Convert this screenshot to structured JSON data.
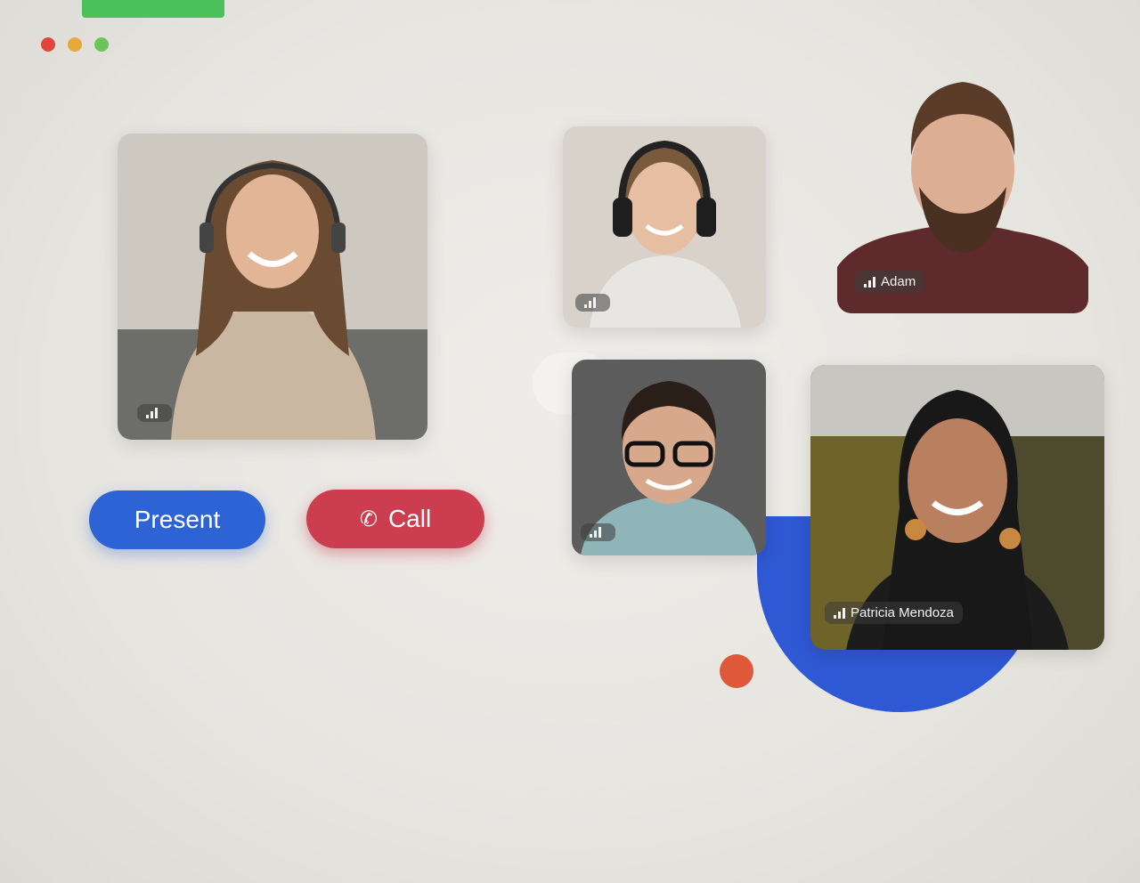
{
  "window": {
    "dots": [
      {
        "name": "close-dot",
        "color": "#e0463d"
      },
      {
        "name": "minimize-dot",
        "color": "#e9a83a"
      },
      {
        "name": "maximize-dot",
        "color": "#6cc35a"
      }
    ]
  },
  "participants": [
    {
      "name": "",
      "role_badge": "",
      "icon": "signal-icon"
    },
    {
      "name": "",
      "icon": "signal-icon"
    },
    {
      "name": "Adam",
      "icon": "signal-icon"
    },
    {
      "name": "",
      "icon": "signal-icon"
    },
    {
      "name": "Patricia Mendoza",
      "icon": "signal-icon"
    }
  ],
  "controls": {
    "present_label": "Present",
    "call_label": "Call",
    "call_icon": "phone-icon"
  },
  "colors": {
    "present": "#2e63d6",
    "call": "#cc3d4f",
    "accent_blob": "#2f58d4",
    "accent_dot": "#e0583a"
  }
}
